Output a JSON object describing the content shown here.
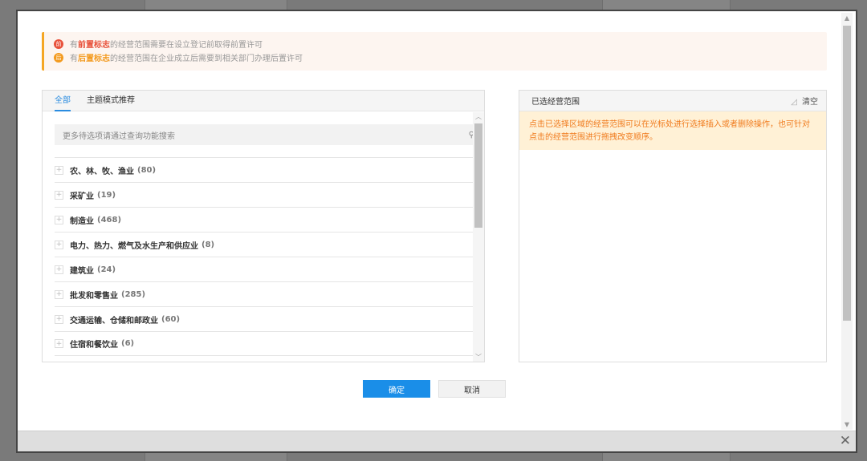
{
  "notice": {
    "line1": {
      "badge": "前",
      "prefix": "有",
      "highlight": "前置标志",
      "suffix": "的经营范围需要在设立登记前取得前置许可"
    },
    "line2": {
      "badge": "后",
      "prefix": "有",
      "highlight": "后置标志",
      "suffix": "的经营范围在企业成立后需要到相关部门办理后置许可"
    }
  },
  "left": {
    "tabs": [
      {
        "label": "全部"
      },
      {
        "label": "主题模式推荐"
      }
    ],
    "search_placeholder": "更多待选项请通过查询功能搜索",
    "items": [
      {
        "label": "农、林、牧、渔业",
        "count": "(80)"
      },
      {
        "label": "采矿业",
        "count": "(19)"
      },
      {
        "label": "制造业",
        "count": "(468)"
      },
      {
        "label": "电力、热力、燃气及水生产和供应业",
        "count": "(8)"
      },
      {
        "label": "建筑业",
        "count": "(24)"
      },
      {
        "label": "批发和零售业",
        "count": "(285)"
      },
      {
        "label": "交通运输、仓储和邮政业",
        "count": "(60)"
      },
      {
        "label": "住宿和餐饮业",
        "count": "(6)"
      }
    ]
  },
  "right": {
    "title": "已选经营范围",
    "clear_label": "清空",
    "tip": "点击已选择区域的经营范围可以在光标处进行选择插入或者删除操作，也可针对点击的经营范围进行拖拽改变顺序。"
  },
  "buttons": {
    "ok": "确定",
    "cancel": "取消"
  },
  "colors": {
    "accent": "#1a8ee8",
    "pre": "#e8513a",
    "post": "#f39a1e"
  }
}
